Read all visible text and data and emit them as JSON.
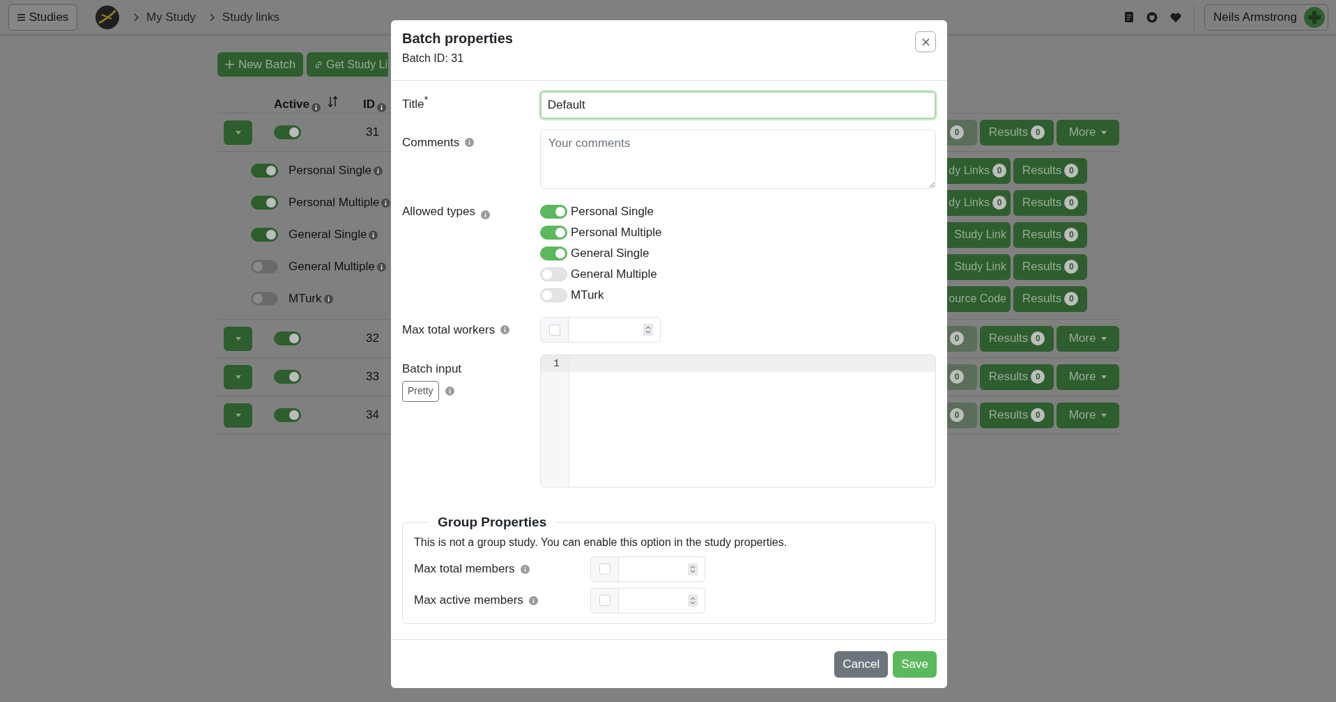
{
  "nav": {
    "menu_button": "Studies",
    "breadcrumbs": [
      "My Study",
      "Study links"
    ],
    "user": "Neils Armstrong"
  },
  "toolbar": {
    "buttons": [
      "New Batch",
      "Get Study Li"
    ]
  },
  "table": {
    "columns": [
      "Active",
      "ID"
    ],
    "batches": [
      {
        "id": "31",
        "active": true,
        "links_count": "0",
        "results": "Results",
        "results_count": "0",
        "more": "More",
        "types": [
          {
            "label": "Personal Single",
            "on": true,
            "link_button": "dy Links",
            "link_count": "0",
            "results": "Results",
            "results_count": "0"
          },
          {
            "label": "Personal Multiple",
            "on": true,
            "link_button": "dy Links",
            "link_count": "0",
            "results": "Results",
            "results_count": "0"
          },
          {
            "label": "General Single",
            "on": true,
            "link_button": "Study Link",
            "results": "Results",
            "results_count": "0"
          },
          {
            "label": "General Multiple",
            "on": false,
            "link_button": "Study Link",
            "results": "Results",
            "results_count": "0"
          },
          {
            "label": "MTurk",
            "on": false,
            "link_button": "ource Code",
            "results": "Results",
            "results_count": "0"
          }
        ]
      },
      {
        "id": "32",
        "active": true,
        "links_count": "0",
        "results": "Results",
        "results_count": "0",
        "more": "More"
      },
      {
        "id": "33",
        "active": true,
        "links_count": "0",
        "results": "Results",
        "results_count": "0",
        "more": "More"
      },
      {
        "id": "34",
        "active": true,
        "links_count": "0",
        "results": "Results",
        "results_count": "0",
        "more": "More"
      }
    ]
  },
  "modal": {
    "title": "Batch properties",
    "subtitle": "Batch ID: 31",
    "title_label": "Title",
    "required_mark": "*",
    "title_value": "Default",
    "comments_label": "Comments",
    "comments_placeholder": "Your comments",
    "allowed_types_label": "Allowed types",
    "allowed_types": [
      {
        "label": "Personal Single",
        "on": true
      },
      {
        "label": "Personal Multiple",
        "on": true
      },
      {
        "label": "General Single",
        "on": true
      },
      {
        "label": "General Multiple",
        "on": false
      },
      {
        "label": "MTurk",
        "on": false
      }
    ],
    "max_workers": {
      "label": "Max total workers",
      "checked": false
    },
    "batch_input_label": "Batch input",
    "pretty_button": "Pretty",
    "line_numbers": [
      "1"
    ],
    "group": {
      "legend": "Group Properties",
      "note": "This is not a group study. You can enable this option in the study properties.",
      "fields": [
        {
          "label": "Max total members",
          "checked": false
        },
        {
          "label": "Max active members",
          "checked": false
        }
      ]
    },
    "buttons": {
      "cancel": "Cancel",
      "save": "Save"
    }
  }
}
